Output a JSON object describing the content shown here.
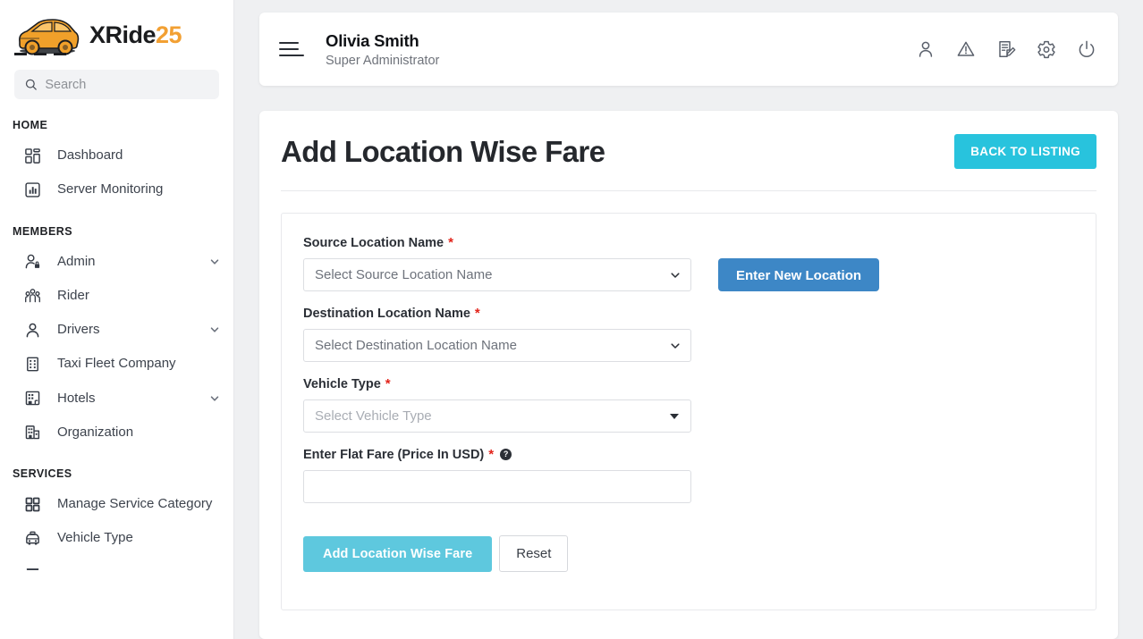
{
  "brand": {
    "name_main": "XRide",
    "name_accent": "25",
    "logo_icon": "car-icon"
  },
  "search": {
    "placeholder": "Search",
    "value": "",
    "icon": "search-icon"
  },
  "sidebar": {
    "sections": [
      {
        "title": "HOME",
        "items": [
          {
            "label": "Dashboard",
            "icon": "dashboard-grid-icon",
            "caret": false
          },
          {
            "label": "Server Monitoring",
            "icon": "chart-bar-icon",
            "caret": false
          }
        ]
      },
      {
        "title": "MEMBERS",
        "items": [
          {
            "label": "Admin",
            "icon": "user-lock-icon",
            "caret": true
          },
          {
            "label": "Rider",
            "icon": "users-group-icon",
            "caret": false
          },
          {
            "label": "Drivers",
            "icon": "user-icon",
            "caret": true
          },
          {
            "label": "Taxi Fleet Company",
            "icon": "building-icon",
            "caret": false
          },
          {
            "label": "Hotels",
            "icon": "hotel-icon",
            "caret": true
          },
          {
            "label": "Organization",
            "icon": "organization-icon",
            "caret": false
          }
        ]
      },
      {
        "title": "SERVICES",
        "items": [
          {
            "label": "Manage Service Category",
            "icon": "grid-squares-icon",
            "caret": false
          },
          {
            "label": "Vehicle Type",
            "icon": "taxi-icon",
            "caret": false
          }
        ]
      }
    ]
  },
  "header": {
    "menu_icon": "hamburger-menu-icon",
    "user_name": "Olivia Smith",
    "user_role": "Super Administrator",
    "icons": [
      "user-profile-icon",
      "warning-triangle-icon",
      "document-edit-icon",
      "gear-settings-icon",
      "power-logout-icon"
    ]
  },
  "page": {
    "title": "Add Location Wise Fare",
    "back_button": "BACK TO LISTING"
  },
  "form": {
    "source_location": {
      "label": "Source Location Name",
      "required": true,
      "placeholder": "Select Source Location Name",
      "value": "Select Source Location Name"
    },
    "new_location_button": "Enter New Location",
    "destination_location": {
      "label": "Destination Location Name",
      "required": true,
      "placeholder": "Select Destination Location Name",
      "value": "Select Destination Location Name"
    },
    "vehicle_type": {
      "label": "Vehicle Type",
      "required": true,
      "placeholder": "Select Vehicle Type",
      "value": "Select Vehicle Type"
    },
    "flat_fare": {
      "label": "Enter Flat Fare (Price In USD)",
      "required": true,
      "help_icon": "question-mark-icon",
      "placeholder": "",
      "value": ""
    },
    "submit_button": "Add Location Wise Fare",
    "reset_button": "Reset"
  },
  "colors": {
    "accent_cyan": "#28c3dd",
    "submit_cyan": "#5ec8de",
    "primary_blue": "#3d87c6",
    "brand_orange": "#f2a033",
    "required_red": "#e2231a",
    "page_background": "#eff0f2"
  }
}
